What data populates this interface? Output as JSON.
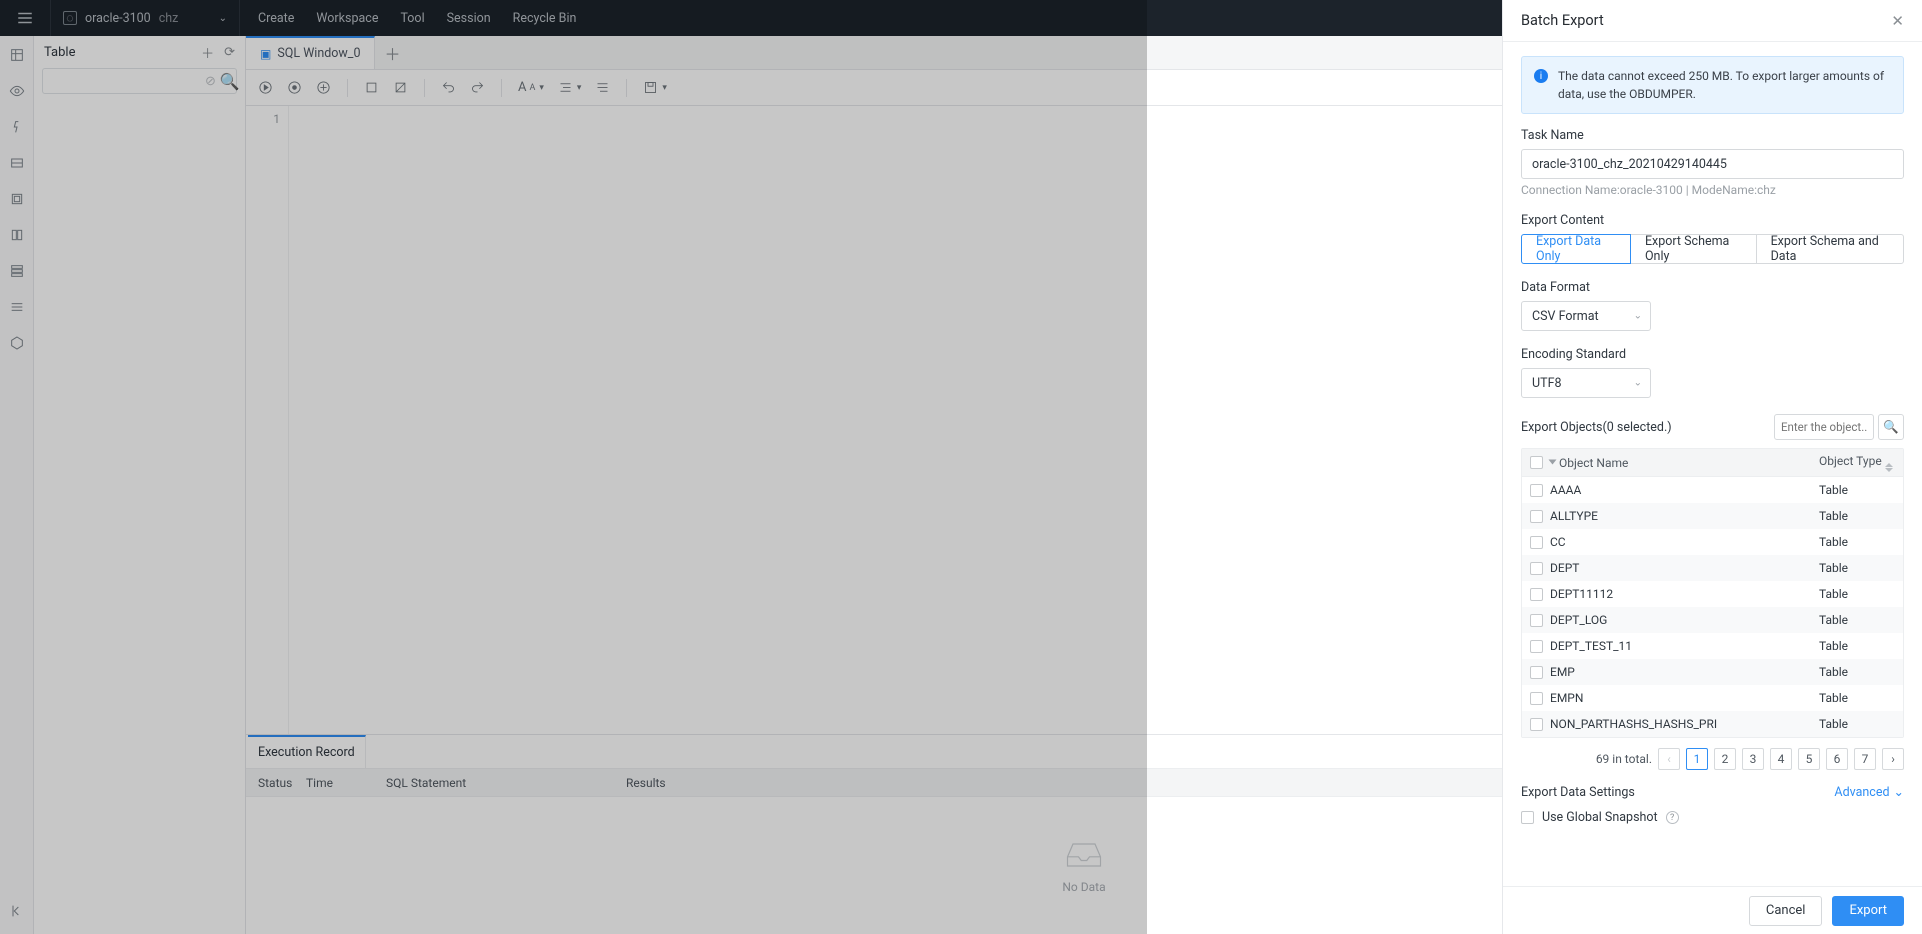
{
  "topbar": {
    "connection_name": "oracle-3100",
    "mode_badge": "chz",
    "menus": [
      "Create",
      "Workspace",
      "Tool",
      "Session",
      "Recycle Bin"
    ]
  },
  "sidepanel": {
    "title": "Table",
    "search_placeholder": ""
  },
  "tabs": {
    "active": "SQL Window_0"
  },
  "editor": {
    "line_number": "1"
  },
  "resultpane": {
    "tab": "Execution Record",
    "columns": [
      "Status",
      "Time",
      "SQL Statement",
      "Results"
    ],
    "empty": "No Data"
  },
  "drawer": {
    "title": "Batch Export",
    "alert": "The data cannot exceed 250 MB. To export larger amounts of data, use the OBDUMPER.",
    "task_name_label": "Task Name",
    "task_name_value": "oracle-3100_chz_20210429140445",
    "conn_hint": "Connection Name:oracle-3100 | ModeName:chz",
    "export_content_label": "Export Content",
    "export_content_options": [
      "Export Data Only",
      "Export Schema Only",
      "Export Schema and Data"
    ],
    "data_format_label": "Data Format",
    "data_format_value": "CSV Format",
    "encoding_label": "Encoding Standard",
    "encoding_value": "UTF8",
    "objects_label": "Export Objects(0 selected.)",
    "objects_search_placeholder": "Enter the object...",
    "objects_columns": [
      "Object Name",
      "Object Type"
    ],
    "objects_rows": [
      {
        "name": "AAAA",
        "type": "Table"
      },
      {
        "name": "ALLTYPE",
        "type": "Table"
      },
      {
        "name": "CC",
        "type": "Table"
      },
      {
        "name": "DEPT",
        "type": "Table"
      },
      {
        "name": "DEPT11112",
        "type": "Table"
      },
      {
        "name": "DEPT_LOG",
        "type": "Table"
      },
      {
        "name": "DEPT_TEST_11",
        "type": "Table"
      },
      {
        "name": "EMP",
        "type": "Table"
      },
      {
        "name": "EMPN",
        "type": "Table"
      },
      {
        "name": "NON_PARTHASHS_HASHS_PRI",
        "type": "Table"
      }
    ],
    "pager_total": "69 in total.",
    "pager_pages": [
      "1",
      "2",
      "3",
      "4",
      "5",
      "6",
      "7"
    ],
    "settings_label": "Export Data Settings",
    "advanced_label": "Advanced",
    "snapshot_label": "Use Global Snapshot",
    "cancel": "Cancel",
    "export": "Export"
  }
}
